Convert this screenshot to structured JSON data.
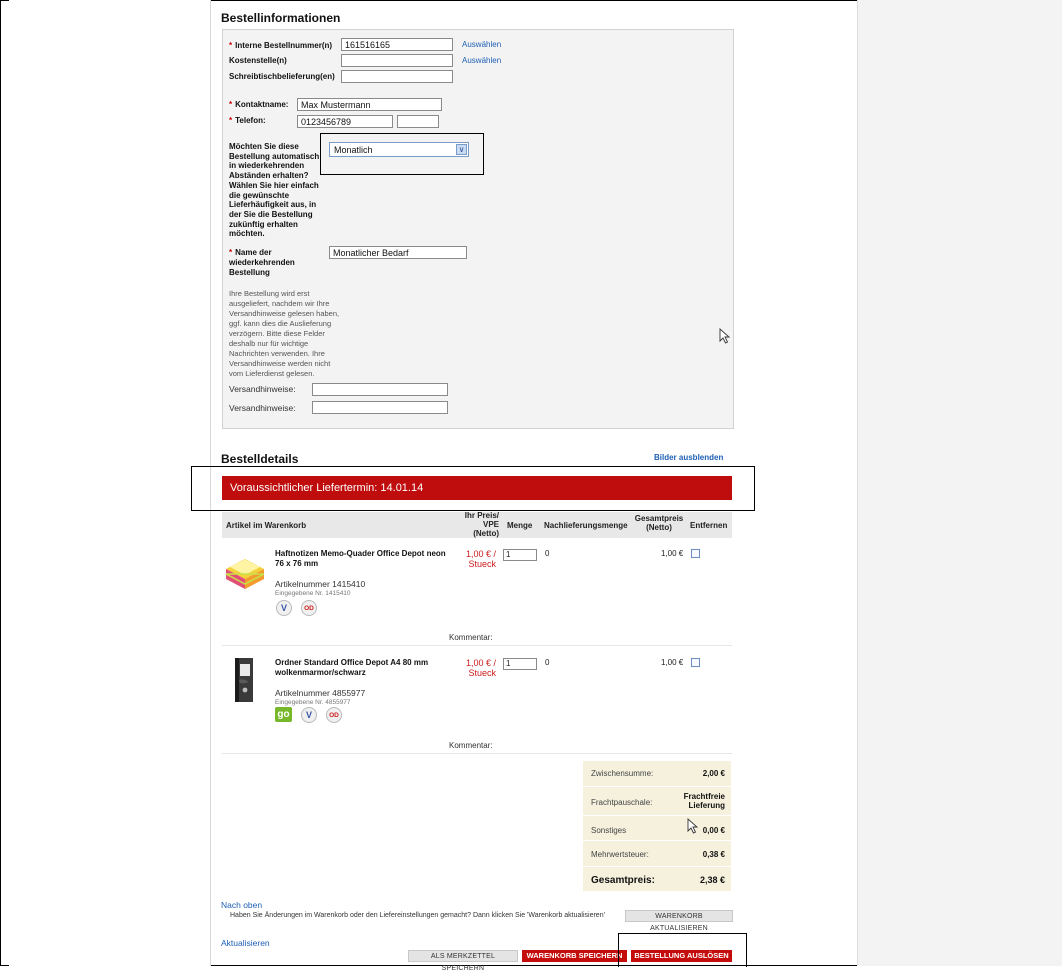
{
  "order_info": {
    "heading": "Bestellinformationen",
    "internal_order_label": "Interne Bestellnummer(n)",
    "internal_order_value": "161516165",
    "internal_order_link": "Auswählen",
    "cost_center_label": "Kostenstelle(n)",
    "cost_center_link": "Auswählen",
    "desk_delivery_label": "Schreibtischbelieferung(en)",
    "contact_label": "Kontaktname:",
    "contact_value": "Max Mustermann",
    "phone_label": "Telefon:",
    "phone_value": "0123456789",
    "recurring_question": "Möchten Sie diese Bestellung automatisch in wiederkehrenden Abständen erhalten? Wählen Sie hier einfach die gewünschte Lieferhäufigkeit aus, in der Sie die Bestellung zukünftig erhalten möchten.",
    "frequency_selected": "Monatlich",
    "recurring_name_label": "Name der wiederkehrenden Bestellung",
    "recurring_name_value": "Monatlicher Bedarf",
    "shipping_note_text": "Ihre Bestellung wird erst ausgeliefert, nachdem wir Ihre Versandhinweise gelesen haben, ggf. kann dies die Auslieferung verzögern. Bitte diese Felder deshalb nur für wichtige Nachrichten verwenden. Ihre Versandhinweise werden nicht vom Lieferdienst gelesen.",
    "shipping_note_label_1": "Versandhinweise:",
    "shipping_note_label_2": "Versandhinweise:"
  },
  "order_details": {
    "heading": "Bestelldetails",
    "hide_images_link": "Bilder ausblenden",
    "delivery_banner": "Voraussichtlicher Liefertermin: 14.01.14",
    "columns": {
      "article": "Artikel im Warenkorb",
      "price": "Ihr Preis/ VPE (Netto)",
      "qty": "Menge",
      "backorder": "Nachlieferungsmenge",
      "total": "Gesamtpreis (Netto)",
      "remove": "Entfernen"
    },
    "items": [
      {
        "name": "Haftnotizen Memo-Quader Office Depot neon 76 x 76 mm",
        "article_nr": "Artikelnummer 1415410",
        "entered_nr": "Eingegebene Nr. 1415410",
        "price": "1,00 € / Stueck",
        "qty": "1",
        "backorder": "0",
        "total": "1,00 €",
        "comment_label": "Kommentar:"
      },
      {
        "name": "Ordner Standard Office Depot A4 80 mm wolkenmarmor/schwarz",
        "article_nr": "Artikelnummer 4855977",
        "entered_nr": "Eingegebene Nr. 4855977",
        "price": "1,00 € / Stueck",
        "qty": "1",
        "backorder": "0",
        "total": "1,00 €",
        "comment_label": "Kommentar:"
      }
    ],
    "badges": {
      "v": "V",
      "od": "OD",
      "go": "go"
    }
  },
  "summary": {
    "subtotal_label": "Zwischensumme:",
    "subtotal_value": "2,00 €",
    "freight_label": "Frachtpauschale:",
    "freight_value": "Frachtfreie Lieferung",
    "other_label": "Sonstiges",
    "other_value": "0,00 €",
    "vat_label": "Mehrwertsteuer:",
    "vat_value": "0,38 €",
    "total_label": "Gesamtpreis:",
    "total_value": "2,38 €"
  },
  "footer": {
    "back_to_top": "Nach oben",
    "update_hint": "Haben Sie Änderungen im Warenkorb oder den Liefereinstellungen gemacht? Dann klicken Sie 'Warenkorb aktualisieren'",
    "update_button": "WARENKORB AKTUALISIEREN",
    "refresh_link": "Aktualisieren",
    "save_wishlist_button": "ALS MERKZETTEL SPEICHERN",
    "save_cart_button": "WARENKORB SPEICHERN",
    "place_order_button": "BESTELLUNG AUSLÖSEN"
  },
  "colors": {
    "accent_red": "#c40c0c",
    "link_blue": "#1e5fb4",
    "summary_bg": "#f5f1dd"
  },
  "icons": [
    "sticky-notes-product-image",
    "binder-product-image",
    "cursor-icon",
    "chevron-down-icon"
  ]
}
